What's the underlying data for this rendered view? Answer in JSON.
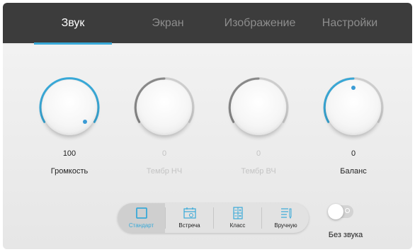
{
  "tabs": [
    {
      "label": "Звук",
      "active": true
    },
    {
      "label": "Экран",
      "active": false
    },
    {
      "label": "Изображение",
      "active": false
    },
    {
      "label": "Настройки",
      "active": false
    }
  ],
  "knobs": [
    {
      "value": "100",
      "label": "Громкость",
      "enabled": true
    },
    {
      "value": "0",
      "label": "Тембр НЧ",
      "enabled": false
    },
    {
      "value": "0",
      "label": "Тембр ВЧ",
      "enabled": false
    },
    {
      "value": "0",
      "label": "Баланс",
      "enabled": true
    }
  ],
  "modes": [
    {
      "label": "Стандарт",
      "icon": "square-icon",
      "active": true
    },
    {
      "label": "Встреча",
      "icon": "calendar-icon",
      "active": false
    },
    {
      "label": "Класс",
      "icon": "calculator-icon",
      "active": false
    },
    {
      "label": "Вручную",
      "icon": "manual-edit-icon",
      "active": false
    }
  ],
  "mute": {
    "label": "Без звука",
    "on": false
  },
  "colors": {
    "accent": "#39a9d8",
    "tabbar": "#3c3c3c",
    "inactive_text": "#8d8d8d",
    "dim_text": "#c4c4c4"
  }
}
